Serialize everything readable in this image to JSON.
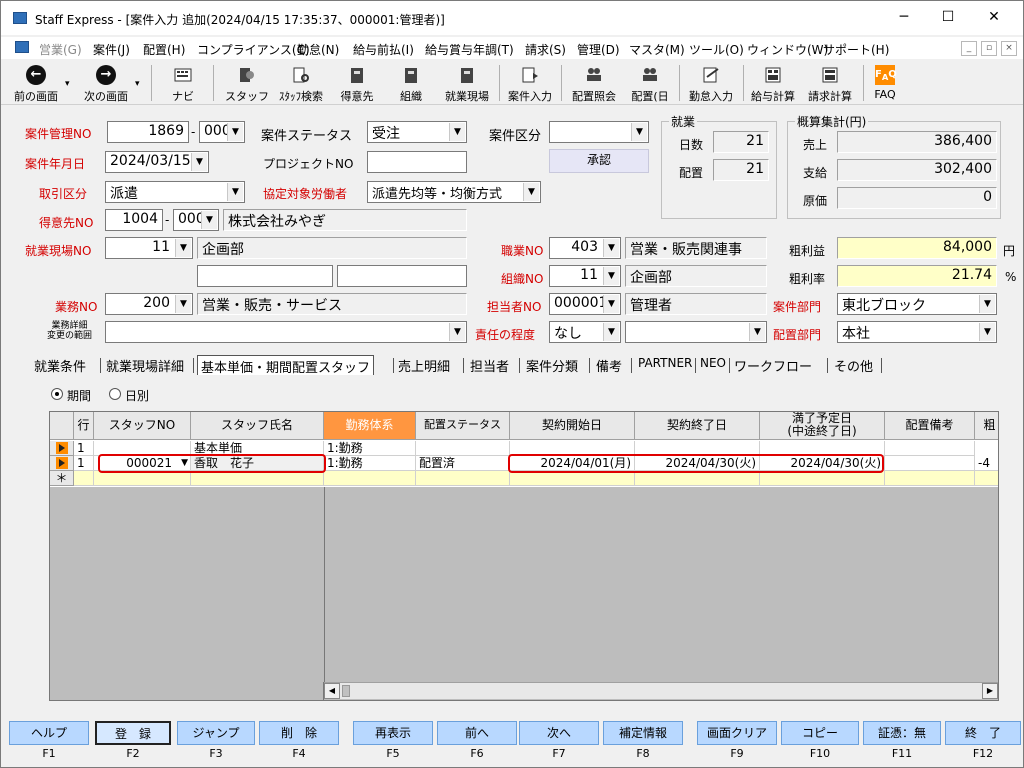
{
  "window": {
    "title": "Staff Express - [案件入力 追加(2024/04/15 17:35:37、000001:管理者)]",
    "min": "─",
    "max": "☐",
    "close": "✕"
  },
  "menu": [
    "営業(G)",
    "案件(J)",
    "配置(H)",
    "コンプライアンス(C)",
    "勤怠(N)",
    "給与前払(I)",
    "給与賞与年調(T)",
    "請求(S)",
    "管理(D)",
    "マスタ(M)",
    "ツール(O)",
    "ウィンドウ(W)",
    "サポート(H)"
  ],
  "mdi": [
    "_",
    "▫",
    "×"
  ],
  "toolbar": [
    {
      "label": "前の画面",
      "icon": "back-arrow-icon"
    },
    {
      "label": "次の画面",
      "icon": "forward-arrow-icon"
    },
    {
      "label": "ナビ",
      "icon": "keyboard-icon"
    },
    {
      "label": "スタッフ",
      "icon": "staff-icon"
    },
    {
      "label": "ｽﾀｯﾌ検索",
      "icon": "staff-search-icon"
    },
    {
      "label": "得意先",
      "icon": "customer-icon"
    },
    {
      "label": "組織",
      "icon": "organization-icon"
    },
    {
      "label": "就業現場",
      "icon": "workplace-icon"
    },
    {
      "label": "案件入力",
      "icon": "case-entry-icon"
    },
    {
      "label": "配置照会",
      "icon": "placement-inquiry-icon"
    },
    {
      "label": "配置(日",
      "icon": "placement-daily-icon"
    },
    {
      "label": "勤怠入力",
      "icon": "attendance-icon"
    },
    {
      "label": "給与計算",
      "icon": "payroll-icon"
    },
    {
      "label": "請求計算",
      "icon": "billing-icon"
    },
    {
      "label": "FAQ",
      "icon": "faq-icon"
    }
  ],
  "form": {
    "case_no_label": "案件管理NO",
    "case_no": "1869",
    "case_no_sep": "-",
    "case_sub": "000",
    "status_label": "案件ステータス",
    "status": "受注",
    "category_label": "案件区分",
    "category": "",
    "date_label": "案件年月日",
    "date": "2024/03/15",
    "project_label": "プロジェクトNO",
    "project": "",
    "approve_btn": "承認",
    "trade_label": "取引区分",
    "trade": "派遣",
    "agreement_label": "協定対象労働者",
    "agreement": "派遣先均等・均衡方式",
    "customer_label": "得意先NO",
    "customer_no": "1004",
    "customer_sep": "-",
    "customer_sub": "000",
    "customer_name": "株式会社みやぎ",
    "site_label": "就業現場NO",
    "site_no": "11",
    "site_name": "企画部",
    "job_label": "職業NO",
    "job_no": "403",
    "job_name": "営業・販売関連事",
    "org_label": "組織NO",
    "org_no": "11",
    "org_name": "企画部",
    "work_label": "業務NO",
    "work_no": "200",
    "work_name": "営業・販売・サービス",
    "owner_label": "担当者NO",
    "owner_no": "000001",
    "owner_name": "管理者",
    "dept_label": "案件部門",
    "dept": "東北ブロック",
    "detail_label1": "業務詳細",
    "detail_label2": "変更の範囲",
    "detail": "",
    "resp_label": "責任の程度",
    "resp": "なし",
    "resp2": "",
    "place_dept_label": "配置部門",
    "place_dept": "本社"
  },
  "employment": {
    "title": "就業",
    "days_label": "日数",
    "days": "21",
    "placed_label": "配置",
    "placed": "21"
  },
  "summary": {
    "title": "概算集計(円)",
    "sales_label": "売上",
    "sales": "386,400",
    "pay_label": "支給",
    "pay": "302,400",
    "cost_label": "原価",
    "cost": "0",
    "profit_label": "粗利益",
    "profit": "84,000",
    "profit_unit": "円",
    "rate_label": "粗利率",
    "rate": "21.74",
    "rate_unit": "%"
  },
  "tabs": [
    "就業条件",
    "就業現場詳細",
    "基本単価・期間配置スタッフ",
    "売上明細",
    "担当者",
    "案件分類",
    "備考",
    "PARTNER",
    "NEO",
    "ワークフロー",
    "その他"
  ],
  "radios": {
    "period": "期間",
    "daily": "日別"
  },
  "grid": {
    "headers": [
      "行",
      "スタッフNO",
      "スタッフ氏名",
      "勤務体系",
      "配置ステータス",
      "契約開始日",
      "契約終了日",
      "満了予定日",
      "(中途終了日)",
      "配置備考",
      "粗"
    ],
    "rows": [
      {
        "row": "1",
        "staff_no": "",
        "staff_name": "基本単価",
        "system": "1:勤務",
        "status": "",
        "start": "",
        "end": "",
        "expire": "",
        "note": ""
      },
      {
        "row": "1",
        "staff_no": "000021",
        "staff_name": "香取　花子",
        "system": "1:勤務",
        "status": "配置済",
        "start": "2024/04/01(月)",
        "end": "2024/04/30(火)",
        "expire": "2024/04/30(火)",
        "note": "",
        "extra": "-4"
      }
    ],
    "new_row_marker": "＊"
  },
  "fkeys": [
    {
      "label": "ヘルプ",
      "key": "F1"
    },
    {
      "label": "登　録",
      "key": "F2"
    },
    {
      "label": "ジャンプ",
      "key": "F3"
    },
    {
      "label": "削　除",
      "key": "F4"
    },
    {
      "label": "再表示",
      "key": "F5"
    },
    {
      "label": "前へ",
      "key": "F6"
    },
    {
      "label": "次へ",
      "key": "F7"
    },
    {
      "label": "補定情報",
      "key": "F8"
    },
    {
      "label": "画面クリア",
      "key": "F9"
    },
    {
      "label": "コピー",
      "key": "F10"
    },
    {
      "label": "証憑：無",
      "key": "F11"
    },
    {
      "label": "終　了",
      "key": "F12"
    }
  ]
}
